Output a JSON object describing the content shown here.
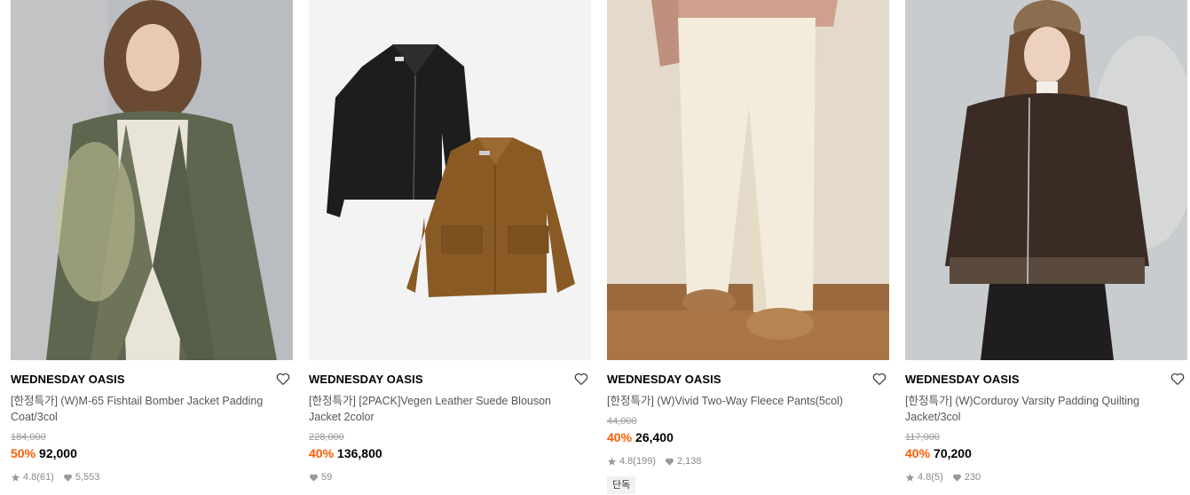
{
  "products": [
    {
      "brand": "WEDNESDAY OASIS",
      "title": "[한정특가] (W)M-65 Fishtail Bomber Jacket Padding Coat/3col",
      "original_price": "184,000",
      "discount": "50%",
      "price": "92,000",
      "rating": "4.8",
      "reviews": "(61)",
      "likes": "5,553",
      "badge": ""
    },
    {
      "brand": "WEDNESDAY OASIS",
      "title": "[한정특가] [2PACK]Vegen Leather Suede Blouson Jacket 2color",
      "original_price": "228,000",
      "discount": "40%",
      "price": "136,800",
      "rating": "",
      "reviews": "",
      "likes": "59",
      "badge": ""
    },
    {
      "brand": "WEDNESDAY OASIS",
      "title": "[한정특가] (W)Vivid Two-Way Fleece Pants(5col)",
      "original_price": "44,000",
      "discount": "40%",
      "price": "26,400",
      "rating": "4.8",
      "reviews": "(199)",
      "likes": "2,138",
      "badge": "단독"
    },
    {
      "brand": "WEDNESDAY OASIS",
      "title": "[한정특가] (W)Corduroy Varsity Padding Quilting Jacket/3col",
      "original_price": "117,000",
      "discount": "40%",
      "price": "70,200",
      "rating": "4.8",
      "reviews": "(5)",
      "likes": "230",
      "badge": ""
    }
  ],
  "icons": {
    "wishlist": "heart-outline-icon",
    "rating": "star-icon",
    "likes": "heart-filled-icon"
  },
  "colors": {
    "discount": "#ff5b00",
    "strikethrough": "#999999",
    "meta": "#888888",
    "badge_bg": "#f1f1f1"
  }
}
